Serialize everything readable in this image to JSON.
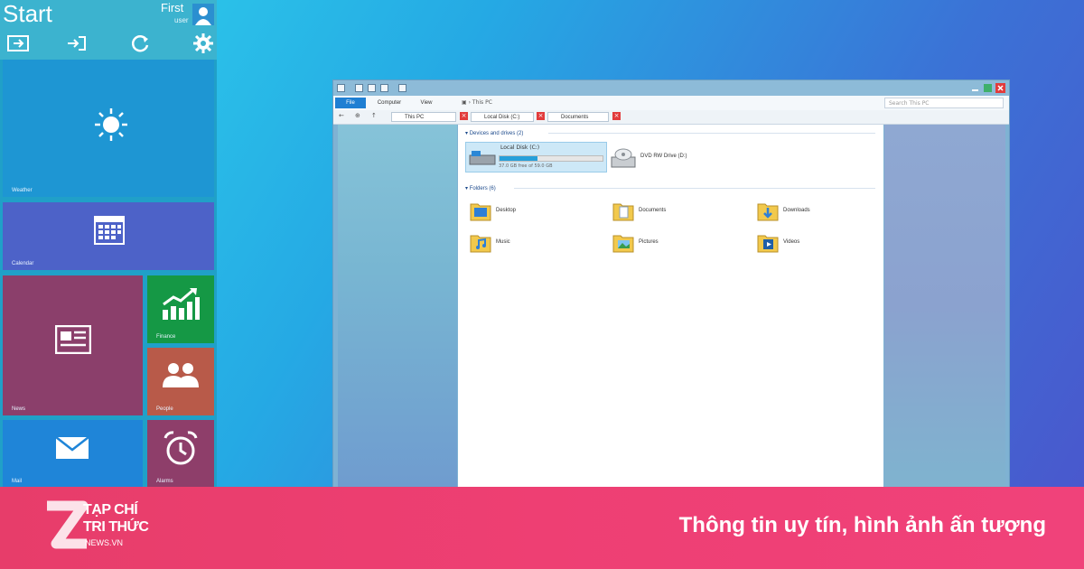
{
  "start_menu": {
    "title": "Start",
    "user_name": "First",
    "user_sub": "user",
    "header_buttons": [
      "run-icon",
      "logoff-icon",
      "restart-icon",
      "settings-icon"
    ],
    "tiles": [
      {
        "label": "Weather",
        "icon": "sun-icon",
        "color": "#1e96d3"
      },
      {
        "label": "Calendar",
        "icon": "calendar-icon",
        "color": "#4d62c8"
      },
      {
        "label": "News",
        "icon": "news-icon",
        "color": "#8b3f6b"
      },
      {
        "label": "Finance",
        "icon": "chart-icon",
        "color": "#159845"
      },
      {
        "label": "People",
        "icon": "people-icon",
        "color": "#b85a49"
      },
      {
        "label": "Mail",
        "icon": "mail-icon",
        "color": "#1f85d8"
      },
      {
        "label": "Alarms",
        "icon": "alarm-icon",
        "color": "#8e3e6a"
      }
    ]
  },
  "explorer": {
    "ribbon_tabs": [
      "File",
      "Computer",
      "View"
    ],
    "address": "This PC",
    "search_placeholder": "Search This PC",
    "folder_tabs": [
      "This PC",
      "Local Disk (C:)",
      "Documents"
    ],
    "devices_header": "Devices and drives (2)",
    "drives": [
      {
        "name": "Local Disk (C:)",
        "free_text": "37.0 GB free of 59.0 GB",
        "used_fraction": 0.37
      }
    ],
    "dvd_label": "DVD RW Drive (D:)",
    "folders_header": "Folders (6)",
    "folders": [
      "Desktop",
      "Documents",
      "Downloads",
      "Music",
      "Pictures",
      "Videos"
    ]
  },
  "footer": {
    "brand_line1": "TẠP CHÍ",
    "brand_line2": "TRI THỨC",
    "brand_line3": "NEWS.VN",
    "slogan": "Thông tin uy tín, hình ảnh ấn tượng"
  }
}
